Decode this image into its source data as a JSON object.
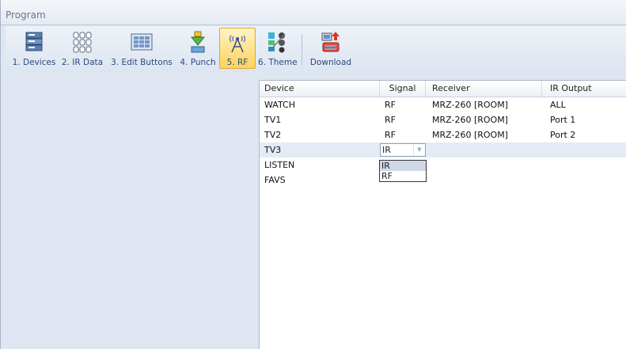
{
  "window": {
    "title": "Program"
  },
  "toolbar": {
    "buttons": [
      {
        "label": "1. Devices",
        "icon": "devices-icon"
      },
      {
        "label": "2. IR Data",
        "icon": "remote-keypad-icon"
      },
      {
        "label": "3. Edit Buttons",
        "icon": "edit-buttons-icon"
      },
      {
        "label": "4. Punch",
        "icon": "punch-icon"
      },
      {
        "label": "5. RF",
        "icon": "rf-antenna-icon",
        "active": true
      },
      {
        "label": "6. Theme",
        "icon": "theme-icon"
      },
      {
        "label": "Download",
        "icon": "download-icon"
      }
    ],
    "active_color": "#ffd35a"
  },
  "grid": {
    "columns": [
      "Device",
      "Signal",
      "Receiver",
      "IR Output"
    ],
    "rows": [
      {
        "device": "WATCH",
        "signal": "RF",
        "receiver": "MRZ-260 [ROOM]",
        "ir_output": "ALL"
      },
      {
        "device": "TV1",
        "signal": "RF",
        "receiver": "MRZ-260 [ROOM]",
        "ir_output": "Port 1"
      },
      {
        "device": "TV2",
        "signal": "RF",
        "receiver": "MRZ-260 [ROOM]",
        "ir_output": "Port 2"
      },
      {
        "device": "TV3",
        "signal": "IR",
        "receiver": "",
        "ir_output": ""
      },
      {
        "device": "LISTEN",
        "signal": "",
        "receiver": "",
        "ir_output": ""
      },
      {
        "device": "FAVS",
        "signal": "",
        "receiver": "",
        "ir_output": ""
      }
    ],
    "selected_row": "TV3",
    "dropdown": {
      "value": "IR",
      "options": [
        "IR",
        "RF"
      ]
    }
  }
}
